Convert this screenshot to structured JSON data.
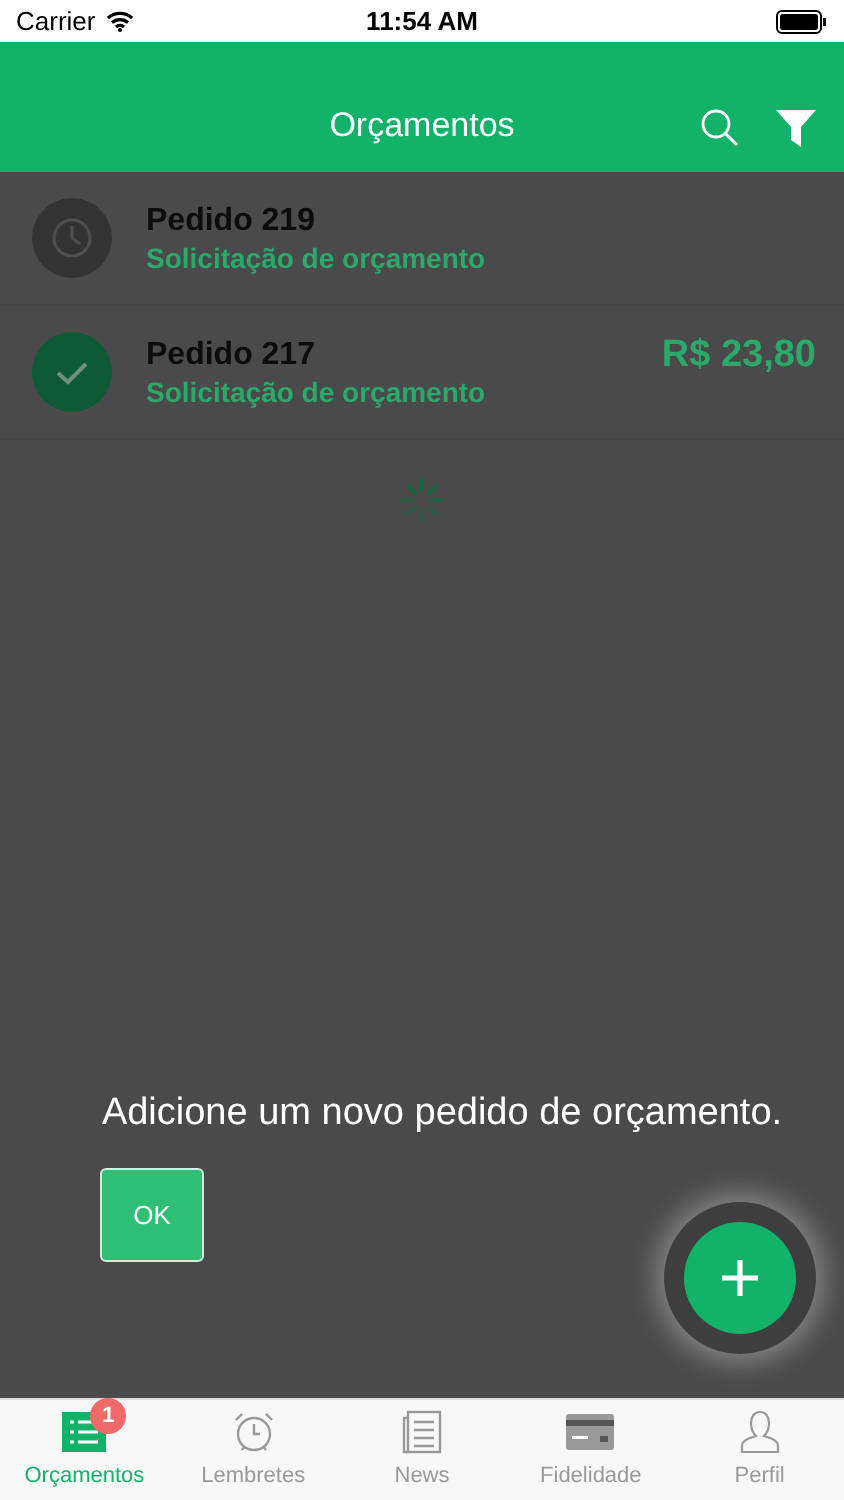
{
  "status_bar": {
    "carrier": "Carrier",
    "time": "11:54 AM"
  },
  "header": {
    "title": "Orçamentos"
  },
  "orders": [
    {
      "kind": "pending",
      "title": "Pedido 219",
      "subtitle": "Solicitação de orçamento"
    },
    {
      "kind": "done",
      "title": "Pedido 217",
      "subtitle": "Solicitação de orçamento",
      "price": "R$ 23,80"
    }
  ],
  "coach": {
    "message": "Adicione um novo pedido de orçamento.",
    "button": "OK"
  },
  "tabs": [
    {
      "label": "Orçamentos",
      "kind": "list",
      "selected": true,
      "badge": "1"
    },
    {
      "label": "Lembretes",
      "kind": "alarm",
      "selected": false
    },
    {
      "label": "News",
      "kind": "news",
      "selected": false
    },
    {
      "label": "Fidelidade",
      "kind": "card",
      "selected": false
    },
    {
      "label": "Perfil",
      "kind": "person",
      "selected": false
    }
  ]
}
